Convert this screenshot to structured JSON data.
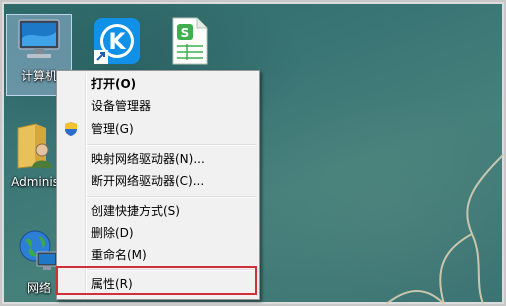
{
  "desktop": {
    "icons": [
      {
        "label": "计算机",
        "icon": "computer-icon"
      },
      {
        "label": "",
        "icon": "kugou-music-icon"
      },
      {
        "label": "",
        "icon": "spreadsheet-icon"
      },
      {
        "label": "Adminis",
        "icon": "user-folder-icon"
      },
      {
        "label": "网络",
        "icon": "network-icon"
      }
    ]
  },
  "context_menu": {
    "items": [
      {
        "label": "打开(O)",
        "bold": true
      },
      {
        "label": "设备管理器"
      },
      {
        "label": "管理(G)",
        "icon": "uac-shield-icon"
      },
      {
        "label": "映射网络驱动器(N)..."
      },
      {
        "label": "断开网络驱动器(C)..."
      },
      {
        "label": "创建快捷方式(S)"
      },
      {
        "label": "删除(D)"
      },
      {
        "label": "重命名(M)"
      },
      {
        "label": "属性(R)"
      }
    ],
    "highlighted_item": "属性(R)",
    "highlight_color": "#d0303a"
  }
}
